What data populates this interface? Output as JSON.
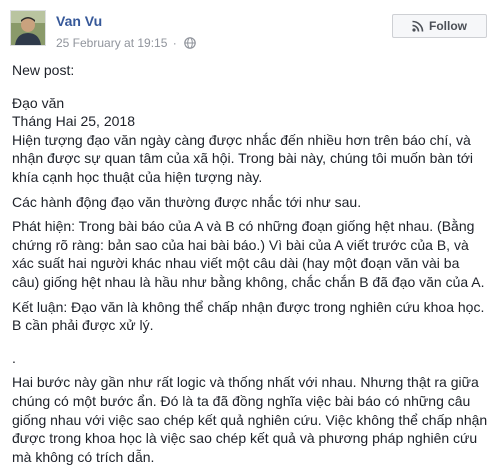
{
  "post": {
    "author": "Van Vu",
    "timestamp": "25 February at 19:15",
    "separator": "·",
    "follow_label": "Follow",
    "body": {
      "intro": "New post:",
      "title": "Đạo văn",
      "date": "Tháng Hai 25, 2018",
      "para1": "Hiện tượng đạo văn ngày càng được nhắc đến nhiều hơn trên báo chí, và nhận được sự quan tâm của xã hội. Trong bài này, chúng tôi muốn bàn tới khía cạnh học thuật của hiện tượng này.",
      "para2": "Các hành động đạo văn thường được nhắc tới như sau.",
      "para3": "Phát hiện: Trong bài báo của A và B có những đoạn giống hệt nhau. (Bằng chứng rõ ràng: bản sao của hai bài báo.) Vì bài của A viết trước của B, và xác suất hai người khác nhau viết một câu dài (hay một đoạn văn vài ba câu) giống hệt nhau là hầu như bằng không, chắc chắn B đã đạo văn của A.",
      "para4": "Kết luận: Đạo văn là không thể chấp nhận được trong nghiên cứu khoa học. B cần phải được xử lý.",
      "para5": ".",
      "para6": "Hai bước này gần như rất logic và thống nhất với nhau. Nhưng thật ra giữa chúng có một bước ẩn. Đó là ta đã đồng nghĩa việc bài báo có những câu giống nhau với việc sao chép kết quả nghiên cứu. Việc không thể chấp nhận được trong khoa học là việc sao chép kết quả và phương pháp nghiên cứu mà không có trích dẫn."
    }
  },
  "icons": {
    "privacy": "globe-icon",
    "follow": "rss-icon",
    "avatar": "profile-photo"
  },
  "colors": {
    "author_link": "#365899",
    "meta_text": "#90949c",
    "body_text": "#1d2129",
    "button_bg": "#f6f7f9"
  }
}
